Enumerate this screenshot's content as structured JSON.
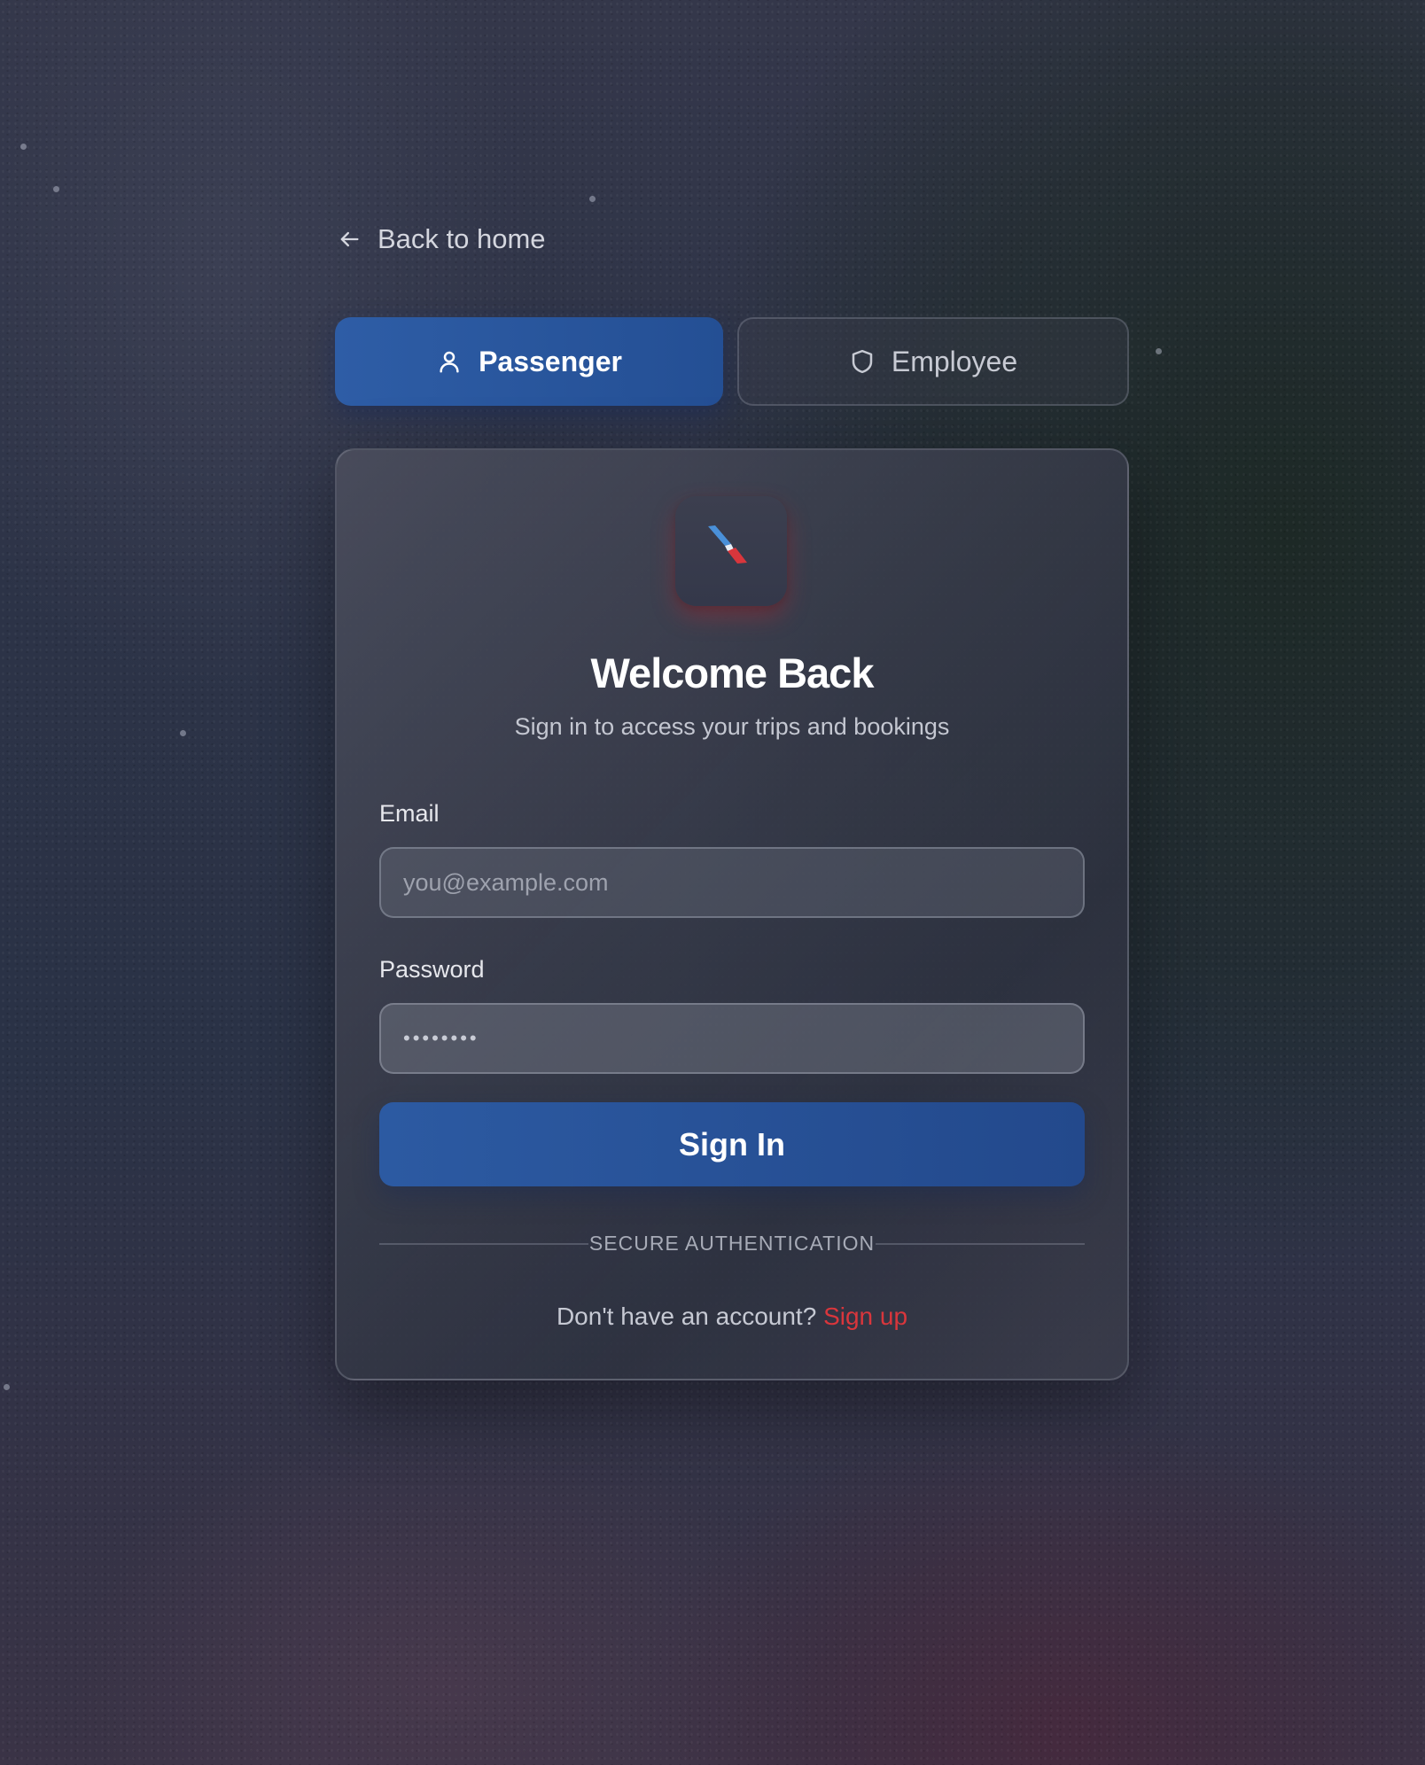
{
  "nav": {
    "back_label": "Back to home"
  },
  "role_tabs": [
    {
      "label": "Passenger",
      "icon": "user-icon",
      "active": true
    },
    {
      "label": "Employee",
      "icon": "shield-icon",
      "active": false
    }
  ],
  "card": {
    "logo_icon": "airline-logo-icon",
    "title": "Welcome Back",
    "subtitle": "Sign in to access your trips and bookings",
    "email": {
      "label": "Email",
      "value": "",
      "placeholder": "you@example.com"
    },
    "password": {
      "label": "Password",
      "masked_value": "••••••••"
    },
    "submit_label": "Sign In",
    "divider_text": "SECURE AUTHENTICATION",
    "signup_prompt": "Don't have an account?",
    "signup_link": "Sign up"
  },
  "colors": {
    "primary": "#2c5aa2",
    "accent_red": "#d9363c",
    "card_bg": "#3a3e4e"
  }
}
